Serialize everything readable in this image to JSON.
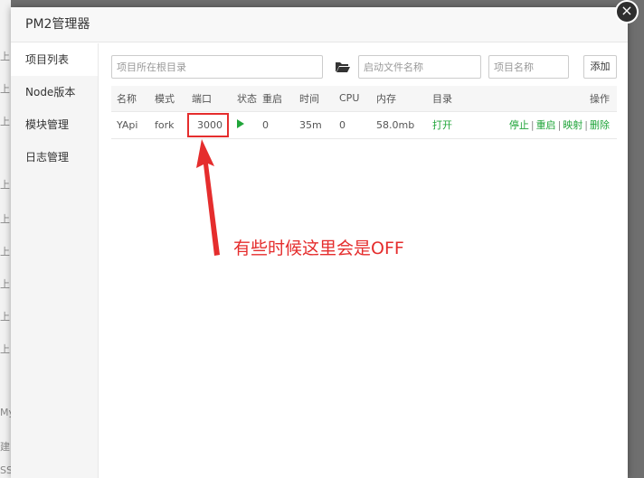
{
  "background": {
    "fragments": [
      "上",
      "上",
      "上",
      "上",
      "上",
      "上",
      "上",
      "上",
      "上",
      "My",
      "建",
      "SS"
    ]
  },
  "modal": {
    "title": "PM2管理器",
    "close_glyph": "×"
  },
  "sidebar": {
    "items": [
      {
        "label": "项目列表",
        "active": true
      },
      {
        "label": "Node版本",
        "active": false
      },
      {
        "label": "模块管理",
        "active": false
      },
      {
        "label": "日志管理",
        "active": false
      }
    ]
  },
  "toolbar": {
    "project_dir_placeholder": "项目所在根目录",
    "start_file_placeholder": "启动文件名称",
    "project_name_placeholder": "项目名称",
    "add_label": "添加"
  },
  "table": {
    "headers": {
      "name": "名称",
      "mode": "模式",
      "port": "端口",
      "status": "状态",
      "restart": "重启",
      "time": "时间",
      "cpu": "CPU",
      "memory": "内存",
      "directory": "目录",
      "actions": "操作"
    },
    "rows": [
      {
        "name": "YApi",
        "mode": "fork",
        "port": "3000",
        "status": "running",
        "restart": "0",
        "time": "35m",
        "cpu": "0",
        "memory": "58.0mb",
        "directory": "打开",
        "actions": {
          "stop": "停止",
          "restart": "重启",
          "map": "映射",
          "delete": "删除"
        }
      }
    ]
  },
  "annotation": {
    "text": "有些时候这里会是OFF",
    "color": "#e52d2d"
  },
  "colors": {
    "accent_green": "#20a53a",
    "annotation_red": "#e52d2d"
  }
}
